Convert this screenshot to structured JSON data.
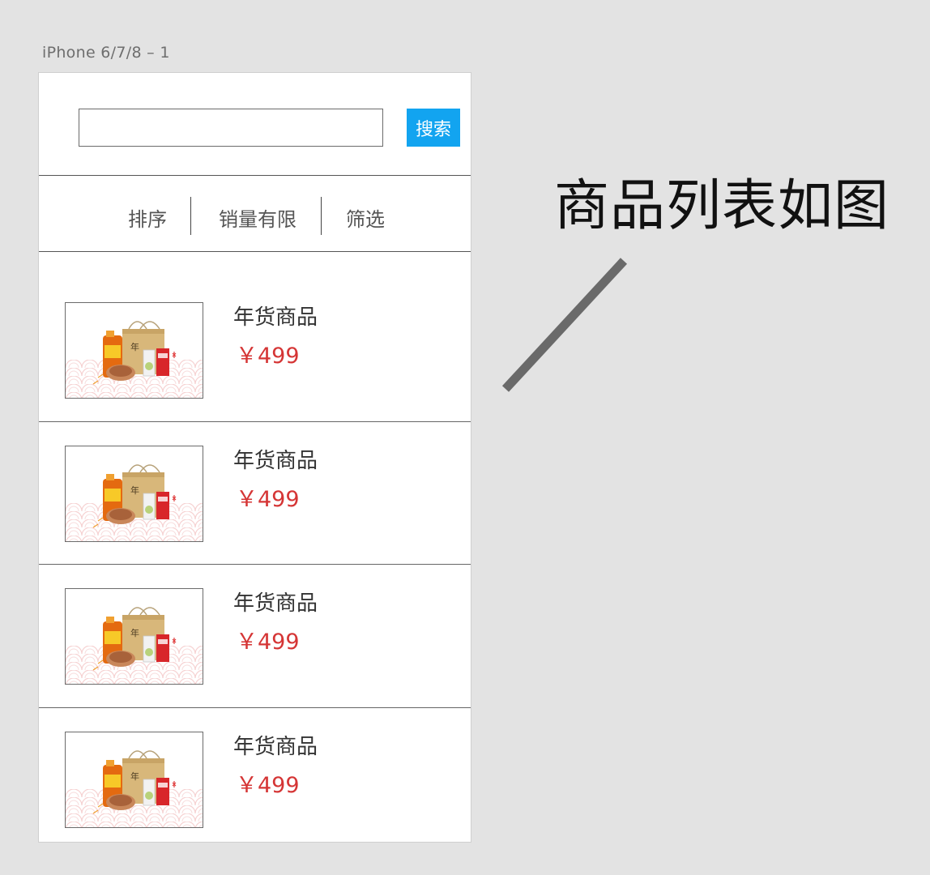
{
  "artboard": {
    "label": "iPhone 6/7/8 – 1"
  },
  "search": {
    "value": "",
    "placeholder": "",
    "button_label": "搜索",
    "button_color": "#12a4f0"
  },
  "filters": [
    {
      "label": "排序"
    },
    {
      "label": "销量有限"
    },
    {
      "label": "筛选"
    }
  ],
  "products": [
    {
      "name": "年货商品",
      "price": "￥499",
      "image": "gift-basket-image"
    },
    {
      "name": "年货商品",
      "price": "￥499",
      "image": "gift-basket-image"
    },
    {
      "name": "年货商品",
      "price": "￥499",
      "image": "gift-basket-image"
    },
    {
      "name": "年货商品",
      "price": "￥499",
      "image": "gift-basket-image"
    }
  ],
  "annotation": {
    "text": "商品列表如图"
  },
  "colors": {
    "price": "#d53535",
    "accent": "#12a4f0",
    "background": "#e3e3e3"
  }
}
